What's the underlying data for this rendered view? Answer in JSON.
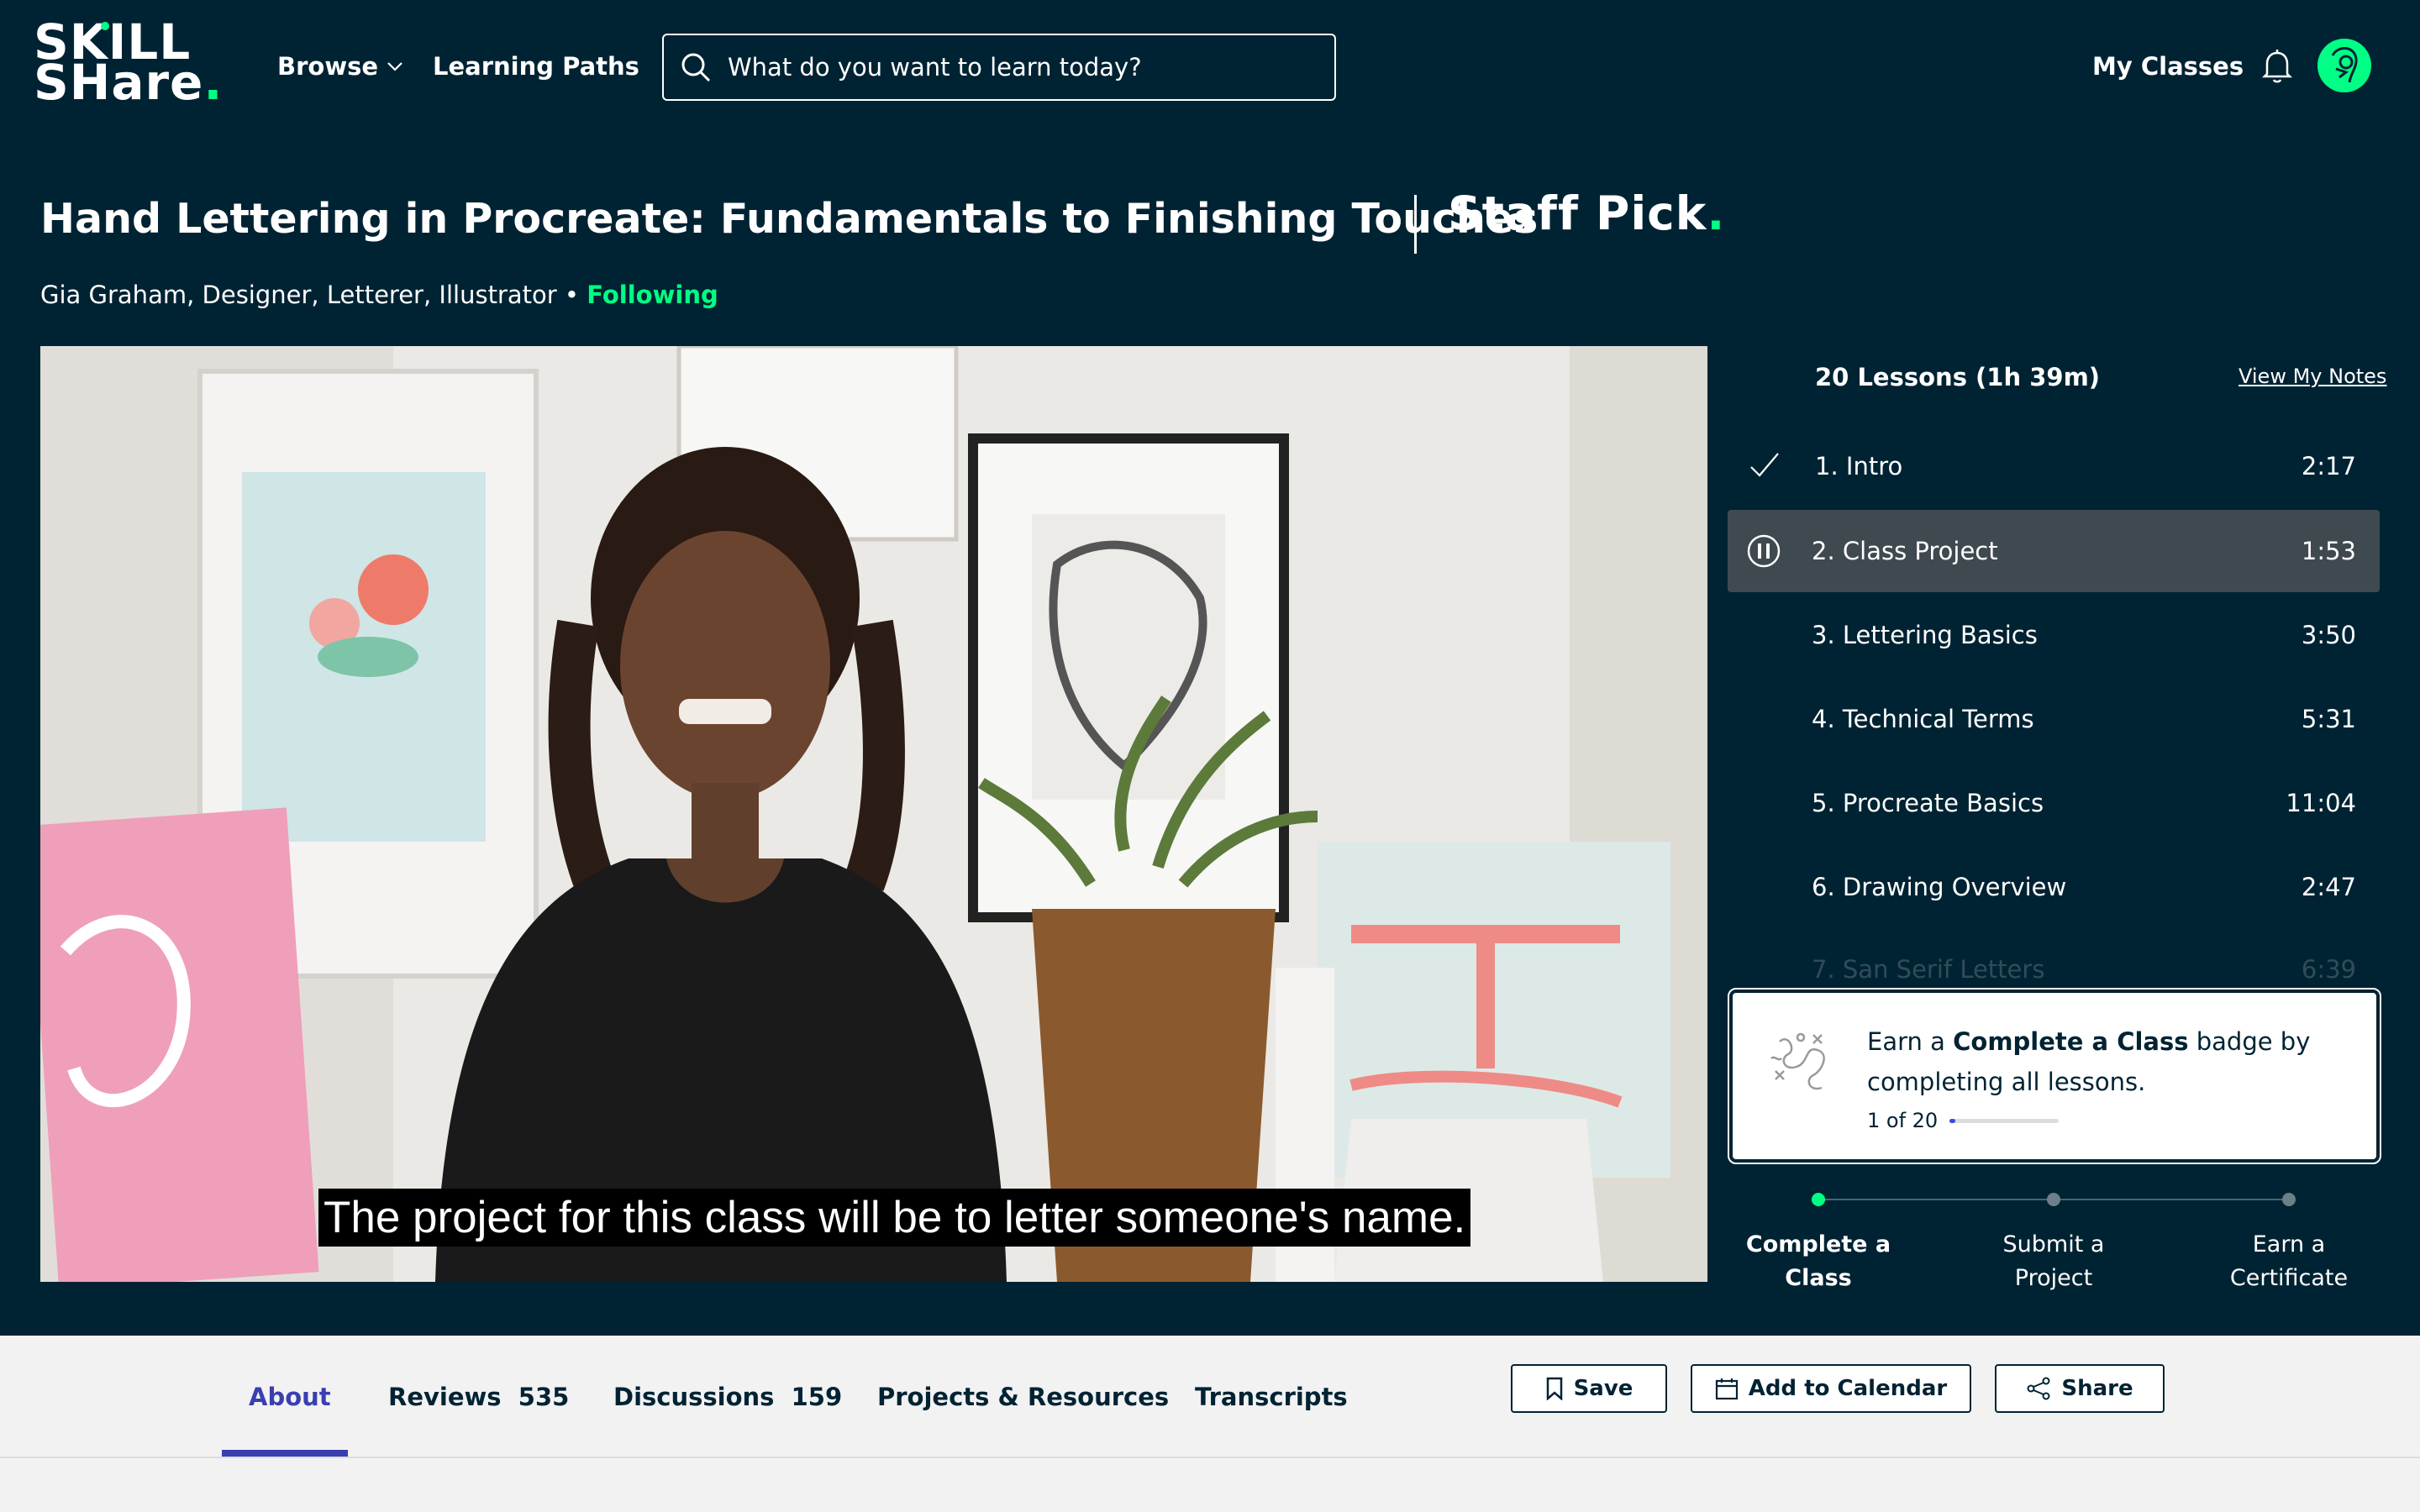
{
  "brand": {
    "line1": "SKILL",
    "line2": "SHare",
    "dot": "."
  },
  "nav": {
    "browse": "Browse",
    "learning_paths": "Learning Paths",
    "my_classes": "My Classes"
  },
  "search": {
    "placeholder": "What do you want to learn today?"
  },
  "class": {
    "title": "Hand Lettering in Procreate: Fundamentals to Finishing Touches",
    "staff_pick": "Staff Pick",
    "staff_pick_dot": ".",
    "teacher": "Gia Graham, Designer, Letterer, Illustrator",
    "separator": " • ",
    "following": "Following"
  },
  "video": {
    "caption": "The project for this class will be to letter someone's name."
  },
  "lessons": {
    "header": "20 Lessons (1h 39m)",
    "view_notes": "View My Notes",
    "items": [
      {
        "title": "1. Intro",
        "duration": "2:17",
        "state": "completed"
      },
      {
        "title": "2. Class Project",
        "duration": "1:53",
        "state": "playing"
      },
      {
        "title": "3. Lettering Basics",
        "duration": "3:50",
        "state": ""
      },
      {
        "title": "4. Technical Terms",
        "duration": "5:31",
        "state": ""
      },
      {
        "title": "5. Procreate Basics",
        "duration": "11:04",
        "state": ""
      },
      {
        "title": "6. Drawing Overview",
        "duration": "2:47",
        "state": ""
      },
      {
        "title": "7. San Serif Letters",
        "duration": "6:39",
        "state": ""
      }
    ]
  },
  "badge": {
    "pre": "Earn a ",
    "strong": "Complete a Class",
    "post": " badge by completing all lessons.",
    "progress_text": "1 of 20",
    "progress_fraction": 0.05
  },
  "steps": [
    {
      "line1": "Complete a",
      "line2": "Class",
      "done": true
    },
    {
      "line1": "Submit a",
      "line2": "Project",
      "done": false
    },
    {
      "line1": "Earn a",
      "line2": "Certificate",
      "done": false
    }
  ],
  "tabs": {
    "about": "About",
    "reviews": "Reviews",
    "reviews_count": "535",
    "discussions": "Discussions",
    "discussions_count": "159",
    "projects": "Projects & Resources",
    "transcripts": "Transcripts"
  },
  "actions": {
    "save": "Save",
    "calendar": "Add to Calendar",
    "share": "Share"
  },
  "colors": {
    "bg": "#002333",
    "accent": "#00ff84",
    "tab_active": "#3a3fb0"
  }
}
